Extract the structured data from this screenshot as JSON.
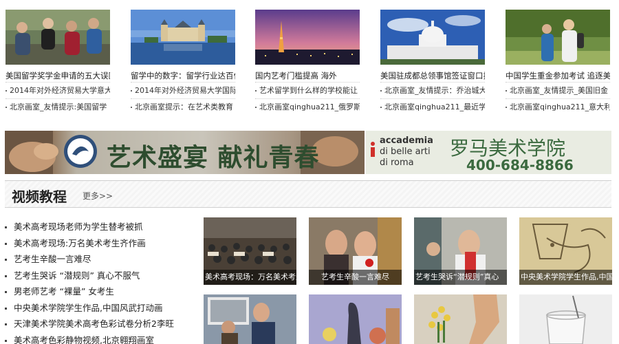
{
  "news_columns": [
    {
      "title": "美国留学奖学金申请的五大误区",
      "links": [
        "2014年对外经济贸易大学意大",
        "北京画室_友情提示:美国留学"
      ]
    },
    {
      "title": "留学中的数字：留学行业达百亿",
      "links": [
        "2014年对外经济贸易大学国际",
        "北京画室提示：在艺术类教育"
      ]
    },
    {
      "title": "国内艺考门槛提高 海外",
      "links": [
        "艺术留学到什么样的学校能让",
        "北京画室qinghua211_俄罗斯"
      ]
    },
    {
      "title": "美国驻成都总领事馆签证窗口扩",
      "links": [
        "北京画室_友情提示：乔治城大",
        "北京画室qinghua211_最近学"
      ]
    },
    {
      "title": "中国学生重金参加考试 追逐美",
      "links": [
        "北京画室_友情提示_美国旧金",
        "北京画室qinghua211_意大利"
      ]
    }
  ],
  "banner": {
    "left_text": "艺术盛宴 献礼青春",
    "right_brand_lines": [
      "accademia",
      "di belle arti",
      "di roma"
    ],
    "right_title": "罗马美术学院",
    "right_phone": "400-684-8866"
  },
  "section": {
    "title": "视频教程",
    "more_label": "更多>>"
  },
  "video_list": [
    "美术高考现场老师为学生替考被抓",
    "美术高考现场:万名美术考生齐作画",
    "艺考生辛酸一言难尽",
    "艺考生哭诉 “潜规则” 真心不服气",
    "男老师艺考 “裸量” 女考生",
    "中央美术学院学生作品,中国风武打动画",
    "天津美术学院美术高考色彩试卷分析2李旺",
    "美术高考色彩静物视频,北京翱翔画室"
  ],
  "video_thumbs_row1": [
    "美术高考现场：万名美术考生",
    "艺考生辛酸一言难尽",
    "艺考生哭诉“潜规则”真心",
    "中央美术学院学生作品,中国"
  ],
  "colors": {
    "banner_green": "#2e4d2f",
    "roma_green": "#3b6a3f",
    "caption_bg": "#000000"
  }
}
